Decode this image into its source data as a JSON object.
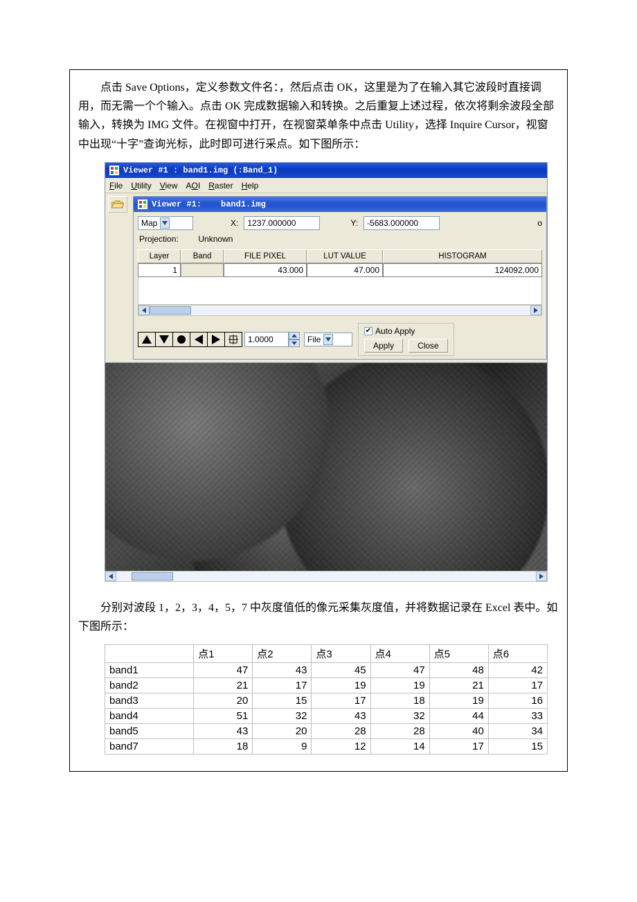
{
  "paragraph1": "点击 Save Options，定义参数文件名：，然后点击 OK，这里是为了在输入其它波段时直接调用，而无需一个个输入。点击 OK 完成数据输入和转换。之后重复上述过程，依次将剩余波段全部输入，转换为 IMG 文件。在视窗中打开，在视窗菜单条中点击 Utility，选择 Inquire Cursor，视窗中出现“十字”查询光标，此时即可进行采点。如下图所示：",
  "paragraph2": "分别对波段 1，2，3，4，5，7 中灰度值低的像元采集灰度值，并将数据记录在 Excel 表中。如下图所示：",
  "outer_window": {
    "title": "Viewer #1 : band1.img (:Band_1)",
    "menu": [
      "File",
      "Utility",
      "View",
      "AOI",
      "Raster",
      "Help"
    ]
  },
  "inner_window": {
    "title_prefix": "Viewer #1:",
    "title_file": "band1.img",
    "coord_mode": "Map",
    "x_label": "X:",
    "x_value": "1237.000000",
    "y_label": "Y:",
    "y_value": "-5683.000000",
    "overflow_char": "o",
    "projection_label": "Projection:",
    "projection_value": "Unknown",
    "table_headers": [
      "Layer",
      "Band",
      "FILE PIXEL",
      "LUT VALUE",
      "HISTOGRAM"
    ],
    "table_row": {
      "layer": "1",
      "band": "",
      "file_pixel": "43.000",
      "lut_value": "47.000",
      "histogram": "124092.000"
    },
    "spinner_value": "1.0000",
    "mode_select": "File",
    "auto_apply_label": "Auto Apply",
    "auto_apply_checked": true,
    "apply_label": "Apply",
    "close_label": "Close",
    "tool_icons": [
      "triangle-up-icon",
      "triangle-down-icon",
      "circle-icon",
      "arrow-left-icon",
      "arrow-right-icon",
      "crosshair-icon"
    ]
  },
  "chart_data": {
    "type": "table",
    "title": "灰度值采样",
    "columns": [
      "",
      "点1",
      "点2",
      "点3",
      "点4",
      "点5",
      "点6"
    ],
    "rows": [
      {
        "label": "band1",
        "values": [
          47,
          43,
          45,
          47,
          48,
          42
        ]
      },
      {
        "label": "band2",
        "values": [
          21,
          17,
          19,
          19,
          21,
          17
        ]
      },
      {
        "label": "band3",
        "values": [
          20,
          15,
          17,
          18,
          19,
          16
        ]
      },
      {
        "label": "band4",
        "values": [
          51,
          32,
          43,
          32,
          44,
          33
        ]
      },
      {
        "label": "band5",
        "values": [
          43,
          20,
          28,
          28,
          40,
          34
        ]
      },
      {
        "label": "band7",
        "values": [
          18,
          9,
          12,
          14,
          17,
          15
        ]
      }
    ]
  }
}
